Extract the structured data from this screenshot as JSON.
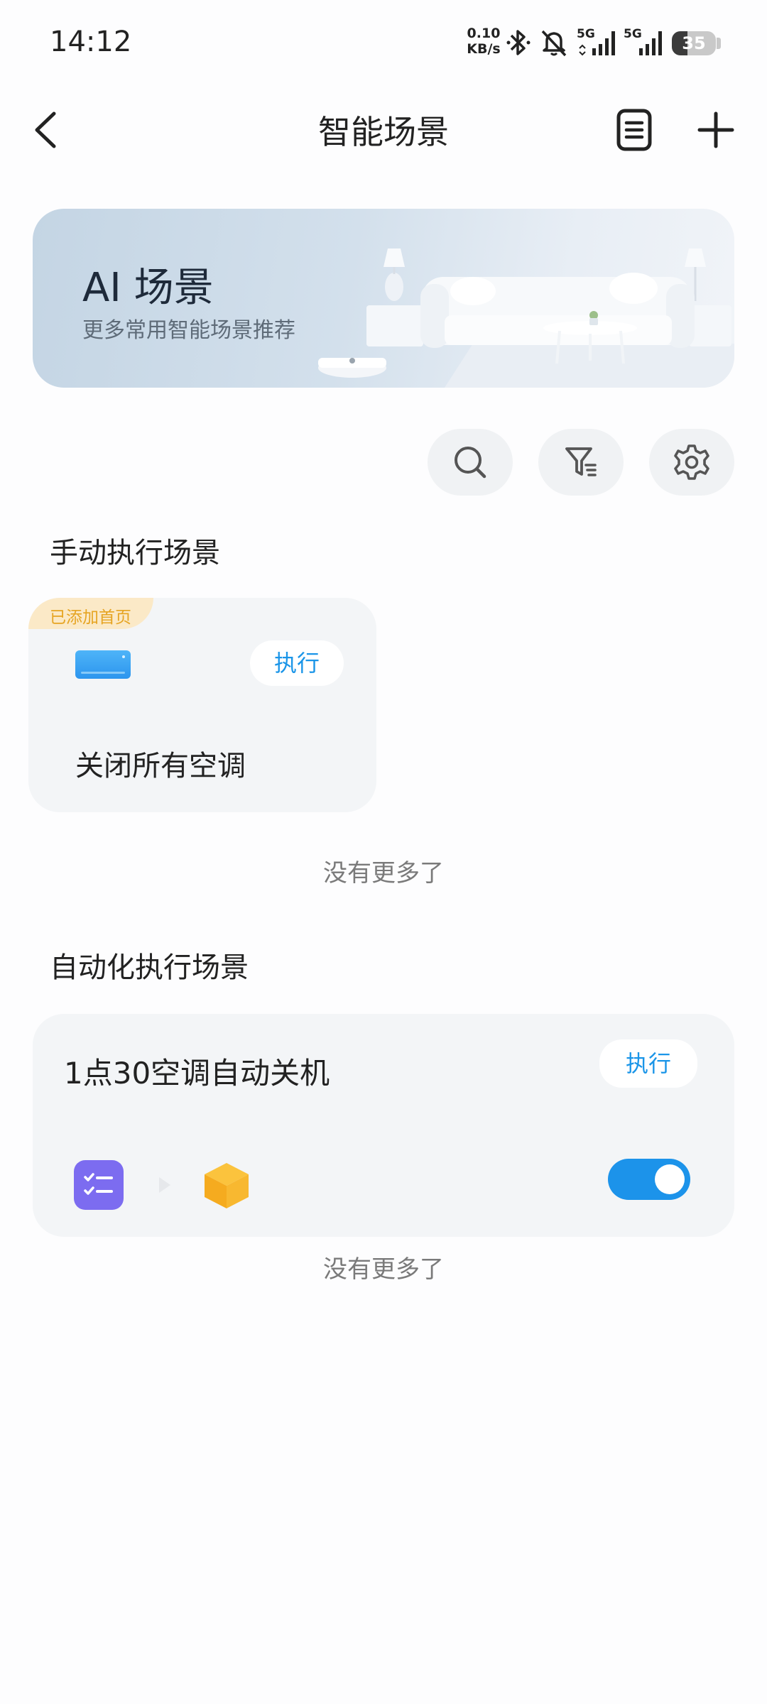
{
  "status_bar": {
    "time": "14:12",
    "net_speed_value": "0.10",
    "net_speed_unit": "KB/s",
    "network_1": "5G",
    "network_2": "5G",
    "battery_level": "35",
    "icons": [
      "bluetooth-icon",
      "mute-bell-icon",
      "signal-5g-icon",
      "signal-5g-icon",
      "battery-icon"
    ]
  },
  "header": {
    "title": "智能场景",
    "icons": [
      "back-icon",
      "log-icon",
      "add-icon"
    ]
  },
  "banner": {
    "title": "AI 场景",
    "subtitle": "更多常用智能场景推荐"
  },
  "toolbar": {
    "icons": [
      "search-icon",
      "filter-icon",
      "settings-icon"
    ]
  },
  "manual_section": {
    "title": "手动执行场景",
    "card": {
      "badge": "已添加首页",
      "execute_label": "执行",
      "name": "关闭所有空调",
      "icon": "air-conditioner-icon"
    },
    "end_text": "没有更多了"
  },
  "auto_section": {
    "title": "自动化执行场景",
    "card": {
      "name": "1点30空调自动关机",
      "execute_label": "执行",
      "condition_icon": "checklist-icon",
      "action_icon": "device-box-icon",
      "enabled": true
    },
    "end_text": "没有更多了"
  },
  "colors": {
    "accent": "#1c93ea",
    "badge_text": "#e6a422",
    "badge_bg": "#fbe9c7",
    "card_bg": "#f3f5f7",
    "condition_icon": "#7c6cf0",
    "action_icon": "#f7b52c"
  }
}
